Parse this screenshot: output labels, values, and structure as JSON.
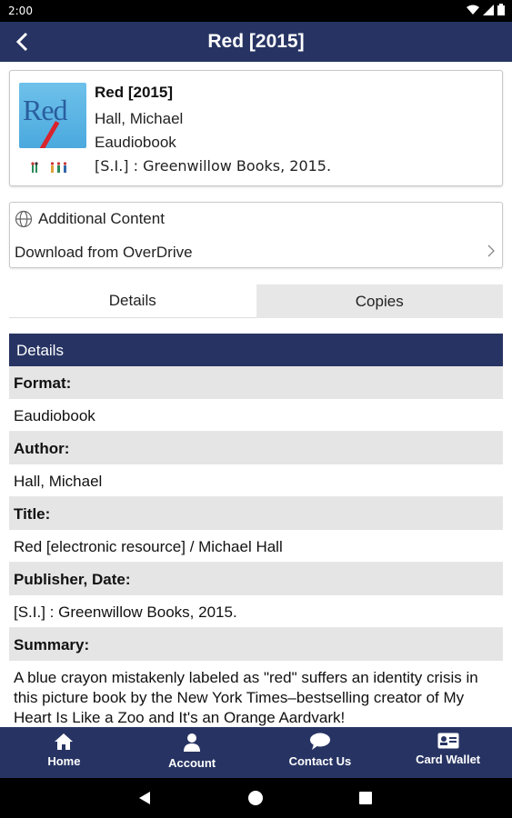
{
  "status_bar": {
    "time": "2:00"
  },
  "app_bar": {
    "title": "Red [2015]"
  },
  "book": {
    "title": "Red [2015]",
    "author": "Hall, Michael",
    "format": "Eaudiobook",
    "publisher": "[S.I.] : Greenwillow Books, 2015.",
    "cover_word": "Red"
  },
  "additional": {
    "label": "Additional Content",
    "download_label": "Download from OverDrive"
  },
  "tabs": [
    {
      "label": "Details",
      "active": true
    },
    {
      "label": "Copies",
      "active": false
    }
  ],
  "details": {
    "header": "Details",
    "fields": [
      {
        "label": "Format:",
        "value": "Eaudiobook"
      },
      {
        "label": "Author:",
        "value": "Hall, Michael"
      },
      {
        "label": "Title:",
        "value": "Red [electronic resource] / Michael Hall"
      },
      {
        "label": "Publisher, Date:",
        "value": "[S.I.] : Greenwillow Books, 2015."
      }
    ],
    "summary_label": "Summary:",
    "summary_text": "A blue crayon mistakenly labeled as \"red\" suffers an identity crisis in this picture book by the New York Times–bestselling creator of My Heart Is Like a Zoo and It's an Orange Aardvark!"
  },
  "bottom_nav": [
    {
      "label": "Home",
      "icon": "home-icon"
    },
    {
      "label": "Account",
      "icon": "person-icon"
    },
    {
      "label": "Contact Us",
      "icon": "chat-icon"
    },
    {
      "label": "Card Wallet",
      "icon": "id-card-icon"
    }
  ],
  "colors": {
    "primary": "#273463",
    "label_bg": "#e5e5e5",
    "cover": "#4ba9de"
  }
}
